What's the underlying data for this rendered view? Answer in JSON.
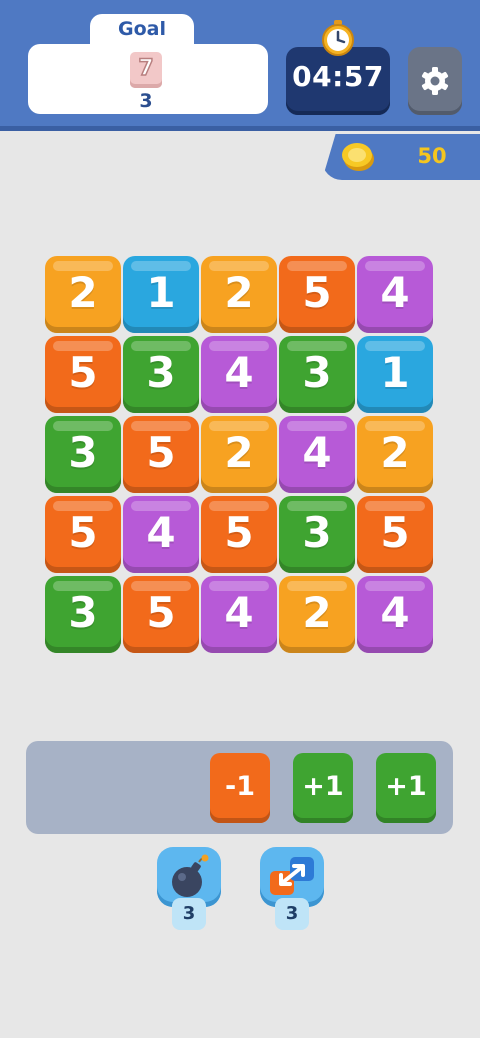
{
  "goal": {
    "title": "Goal",
    "tile_value": "7",
    "count": "3"
  },
  "timer": {
    "time": "04:57",
    "icon": "stopwatch-icon"
  },
  "settings": {
    "icon": "gear-icon"
  },
  "coins": {
    "count": "50",
    "icon": "coin-icon"
  },
  "colors": {
    "orange": "#f7a221",
    "blue": "#2aa7df",
    "red_orange": "#f26a1b",
    "purple": "#b75ad7",
    "green": "#3fa431"
  },
  "board": [
    [
      {
        "value": "2",
        "color": "orange"
      },
      {
        "value": "1",
        "color": "blue"
      },
      {
        "value": "2",
        "color": "orange"
      },
      {
        "value": "5",
        "color": "red_orange"
      },
      {
        "value": "4",
        "color": "purple"
      }
    ],
    [
      {
        "value": "5",
        "color": "red_orange"
      },
      {
        "value": "3",
        "color": "green"
      },
      {
        "value": "4",
        "color": "purple"
      },
      {
        "value": "3",
        "color": "green"
      },
      {
        "value": "1",
        "color": "blue"
      }
    ],
    [
      {
        "value": "3",
        "color": "green"
      },
      {
        "value": "5",
        "color": "red_orange"
      },
      {
        "value": "2",
        "color": "orange"
      },
      {
        "value": "4",
        "color": "purple"
      },
      {
        "value": "2",
        "color": "orange"
      }
    ],
    [
      {
        "value": "5",
        "color": "red_orange"
      },
      {
        "value": "4",
        "color": "purple"
      },
      {
        "value": "5",
        "color": "red_orange"
      },
      {
        "value": "3",
        "color": "green"
      },
      {
        "value": "5",
        "color": "red_orange"
      }
    ],
    [
      {
        "value": "3",
        "color": "green"
      },
      {
        "value": "5",
        "color": "red_orange"
      },
      {
        "value": "4",
        "color": "purple"
      },
      {
        "value": "2",
        "color": "orange"
      },
      {
        "value": "4",
        "color": "purple"
      }
    ]
  ],
  "tray": [
    {
      "label": "-1",
      "color": "red_orange"
    },
    {
      "label": "+1",
      "color": "green"
    },
    {
      "label": "+1",
      "color": "green"
    }
  ],
  "boosters": [
    {
      "icon": "bomb-icon",
      "count": "3"
    },
    {
      "icon": "swap-icon",
      "count": "3"
    }
  ]
}
